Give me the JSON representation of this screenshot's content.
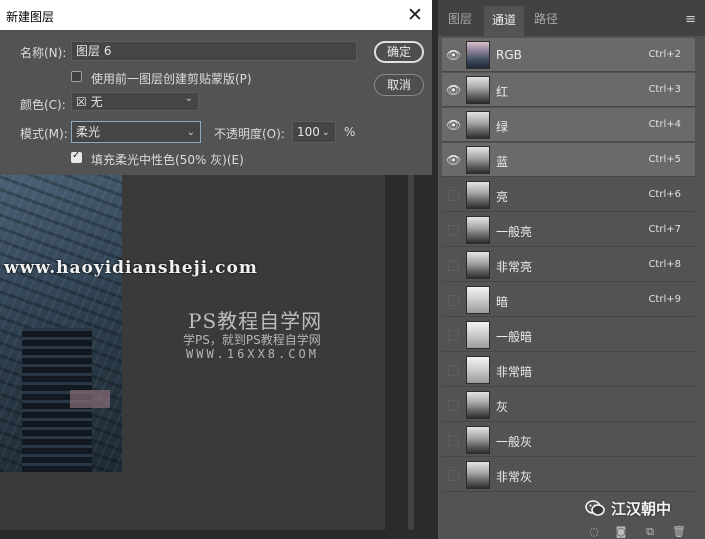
{
  "dialog": {
    "title": "新建图层",
    "close_glyph": "✕",
    "name_label": "名称(N):",
    "name_value": "图层 6",
    "clip_label": "使用前一图层创建剪贴蒙版(P)",
    "clip_checked": false,
    "color_label": "颜色(C):",
    "color_value": "无",
    "color_swatch_glyph": "☒",
    "mode_label": "模式(M):",
    "mode_value": "柔光",
    "opacity_label": "不透明度(O):",
    "opacity_value": "100",
    "opacity_unit": "%",
    "fill_label": "填充柔光中性色(50% 灰)(E)",
    "fill_checked": true,
    "ok_label": "确定",
    "cancel_label": "取消"
  },
  "watermark": {
    "url": "www.haoyidiansheji.com",
    "title": "PS教程自学网",
    "subtitle": "学PS，就到PS教程自学网",
    "site": "WWW.16XX8.COM"
  },
  "panel": {
    "tabs": [
      {
        "label": "图层",
        "active": false
      },
      {
        "label": "通道",
        "active": true
      },
      {
        "label": "路径",
        "active": false
      }
    ],
    "menu_glyph": "≡",
    "channels": [
      {
        "name": "RGB",
        "shortcut": "Ctrl+2",
        "visible": true,
        "thumb": "color"
      },
      {
        "name": "红",
        "shortcut": "Ctrl+3",
        "visible": true,
        "thumb": "gray"
      },
      {
        "name": "绿",
        "shortcut": "Ctrl+4",
        "visible": true,
        "thumb": "gray"
      },
      {
        "name": "蓝",
        "shortcut": "Ctrl+5",
        "visible": true,
        "thumb": "gray"
      },
      {
        "name": "亮",
        "shortcut": "Ctrl+6",
        "visible": false,
        "thumb": "gray"
      },
      {
        "name": "一般亮",
        "shortcut": "Ctrl+7",
        "visible": false,
        "thumb": "gray"
      },
      {
        "name": "非常亮",
        "shortcut": "Ctrl+8",
        "visible": false,
        "thumb": "gray"
      },
      {
        "name": "暗",
        "shortcut": "Ctrl+9",
        "visible": false,
        "thumb": "light"
      },
      {
        "name": "一般暗",
        "shortcut": "",
        "visible": false,
        "thumb": "light"
      },
      {
        "name": "非常暗",
        "shortcut": "",
        "visible": false,
        "thumb": "light"
      },
      {
        "name": "灰",
        "shortcut": "",
        "visible": false,
        "thumb": "gray"
      },
      {
        "name": "一般灰",
        "shortcut": "",
        "visible": false,
        "thumb": "gray"
      },
      {
        "name": "非常灰",
        "shortcut": "",
        "visible": false,
        "thumb": "gray"
      }
    ],
    "bottom_icons": [
      "dotted-circle-icon",
      "mask-icon",
      "new-channel-icon",
      "trash-icon"
    ]
  },
  "branding": {
    "wechat_label": "江汉朝中"
  }
}
